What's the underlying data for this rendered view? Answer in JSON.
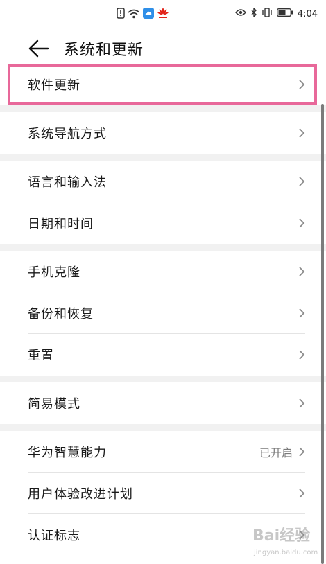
{
  "status_bar": {
    "time": "4:04",
    "left_icons": [
      "alert-icon",
      "wifi-icon",
      "cloud-icon",
      "huawei-logo-icon"
    ],
    "right_icons": [
      "eye-icon",
      "bluetooth-icon",
      "vibrate-icon",
      "battery-icon"
    ]
  },
  "header": {
    "title": "系统和更新",
    "back_icon": "arrow-left-icon"
  },
  "groups": [
    {
      "items": [
        {
          "label": "软件更新"
        }
      ]
    },
    {
      "items": [
        {
          "label": "系统导航方式"
        }
      ]
    },
    {
      "items": [
        {
          "label": "语言和输入法"
        },
        {
          "label": "日期和时间"
        }
      ]
    },
    {
      "items": [
        {
          "label": "手机克隆"
        },
        {
          "label": "备份和恢复"
        },
        {
          "label": "重置"
        }
      ]
    },
    {
      "items": [
        {
          "label": "简易模式"
        }
      ]
    },
    {
      "items": [
        {
          "label": "华为智慧能力",
          "value": "已开启"
        },
        {
          "label": "用户体验改进计划"
        },
        {
          "label": "认证标志"
        }
      ]
    }
  ],
  "colors": {
    "highlight": "#e8689a",
    "background": "#f1f1f1",
    "row_background": "#ffffff"
  },
  "highlighted_item": "软件更新",
  "watermark": {
    "text": "Bai经验",
    "subtext": "jingyan.baidu.com"
  }
}
